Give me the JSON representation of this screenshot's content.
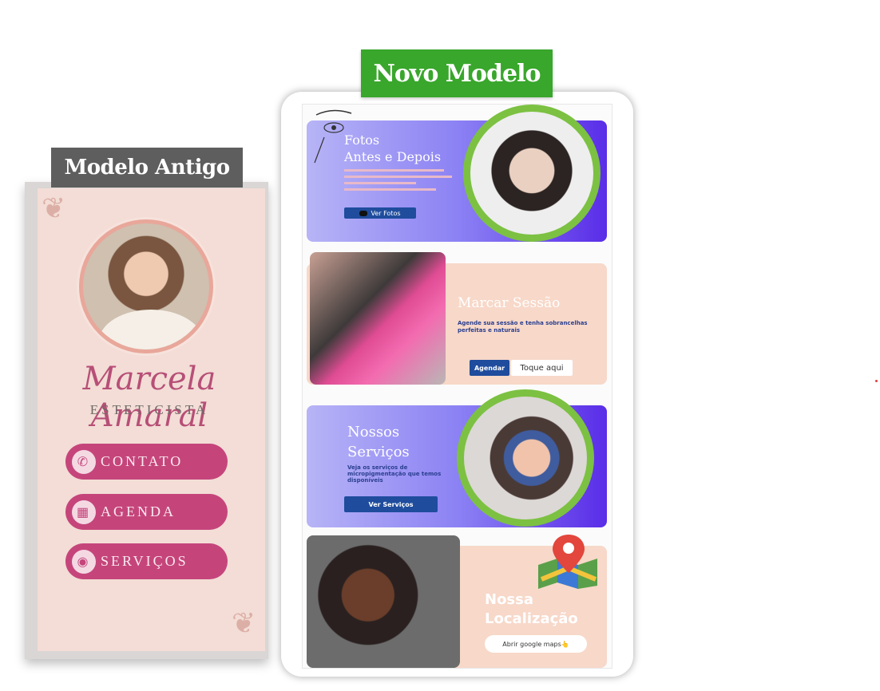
{
  "old_model": {
    "tag": "Modelo Antigo",
    "name": "Marcela Amaral",
    "role": "ESTETICISTA",
    "buttons": [
      {
        "label": "CONTATO",
        "icon": "phone-icon"
      },
      {
        "label": "AGENDA",
        "icon": "calendar-icon"
      },
      {
        "label": "SERVIÇOS",
        "icon": "lips-icon"
      }
    ]
  },
  "new_model": {
    "tag": "Novo Modelo",
    "cards": {
      "photos": {
        "title_line1": "Fotos",
        "title_line2": "Antes e Depois",
        "button": "Ver Fotos"
      },
      "session": {
        "title": "Marcar Sessão",
        "desc": "Agende sua sessão e tenha sobrancelhas perfeitas e naturais",
        "button_primary": "Agendar",
        "button_secondary": "Toque aqui"
      },
      "services": {
        "title_line1": "Nossos",
        "title_line2": "Serviços",
        "desc": "Veja os serviços de micropigmentação que temos disponíveis",
        "button": "Ver Serviços"
      },
      "location": {
        "title_line1": "Nossa",
        "title_line2": "Localização",
        "button": "Abrir google maps👆"
      }
    }
  },
  "colors": {
    "green": "#39a62c",
    "pink": "#c5457b",
    "gray_tag": "#5e5e5e",
    "peach": "#f7d8c9",
    "purple": "#5a2de8"
  }
}
